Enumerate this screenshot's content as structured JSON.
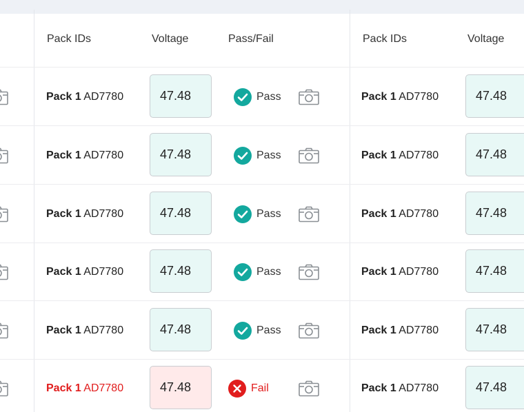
{
  "columns": {
    "left_group": {
      "pack_ids": "Pack IDs",
      "voltage": "Voltage",
      "pass_fail": "Pass/Fail"
    },
    "right_group": {
      "pack_ids": "Pack IDs",
      "voltage": "Voltage"
    }
  },
  "left_rows": [
    {
      "pack_prefix": "Pack 1",
      "pack_code": "AD7780",
      "voltage": "47.48",
      "status": "Pass"
    },
    {
      "pack_prefix": "Pack 1",
      "pack_code": "AD7780",
      "voltage": "47.48",
      "status": "Pass"
    },
    {
      "pack_prefix": "Pack 1",
      "pack_code": "AD7780",
      "voltage": "47.48",
      "status": "Pass"
    },
    {
      "pack_prefix": "Pack 1",
      "pack_code": "AD7780",
      "voltage": "47.48",
      "status": "Pass"
    },
    {
      "pack_prefix": "Pack 1",
      "pack_code": "AD7780",
      "voltage": "47.48",
      "status": "Pass"
    },
    {
      "pack_prefix": "Pack 1",
      "pack_code": "AD7780",
      "voltage": "47.48",
      "status": "Fail"
    }
  ],
  "right_rows": [
    {
      "pack_prefix": "Pack 1",
      "pack_code": "AD7780",
      "voltage": "47.48"
    },
    {
      "pack_prefix": "Pack 1",
      "pack_code": "AD7780",
      "voltage": "47.48"
    },
    {
      "pack_prefix": "Pack 1",
      "pack_code": "AD7780",
      "voltage": "47.48"
    },
    {
      "pack_prefix": "Pack 1",
      "pack_code": "AD7780",
      "voltage": "47.48"
    },
    {
      "pack_prefix": "Pack 1",
      "pack_code": "AD7780",
      "voltage": "47.48"
    },
    {
      "pack_prefix": "Pack 1",
      "pack_code": "AD7780",
      "voltage": "47.48"
    }
  ],
  "icons": {
    "pass": "check-circle-icon",
    "fail": "x-circle-icon",
    "photo": "camera-icon"
  },
  "colors": {
    "pass_green": "#13a89e",
    "fail_red": "#e11d1d",
    "pass_field_bg": "#e8f8f6",
    "fail_field_bg": "#ffeaea",
    "top_bar": "#eef1f6"
  }
}
